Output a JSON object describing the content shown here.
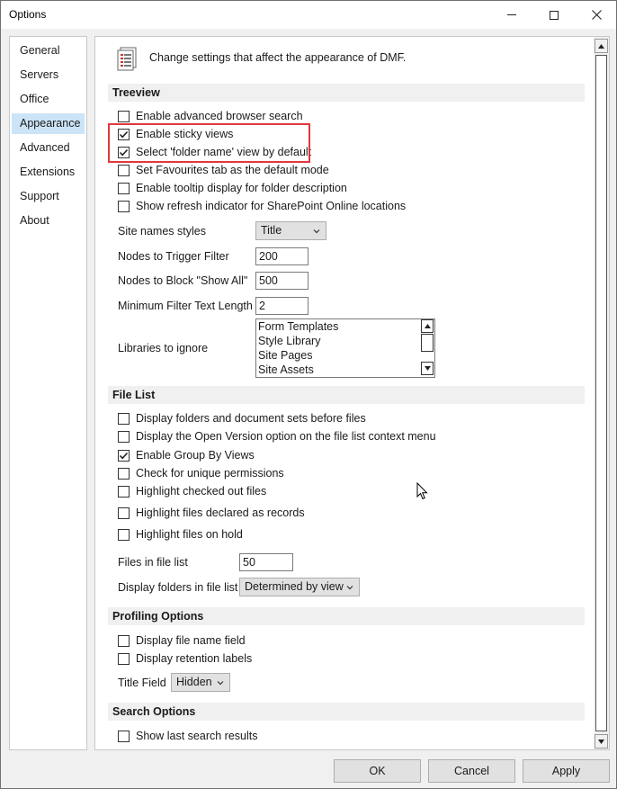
{
  "window": {
    "title": "Options"
  },
  "titlebar_buttons": {
    "minimize": "minimize-icon",
    "maximize": "maximize-icon",
    "close": "close-icon"
  },
  "nav": {
    "items": [
      {
        "label": "General"
      },
      {
        "label": "Servers"
      },
      {
        "label": "Office"
      },
      {
        "label": "Appearance",
        "selected": true
      },
      {
        "label": "Advanced"
      },
      {
        "label": "Extensions"
      },
      {
        "label": "Support"
      },
      {
        "label": "About"
      }
    ]
  },
  "header": {
    "text": "Change settings that affect the appearance of DMF.",
    "icon": "settings-document-icon"
  },
  "treeview": {
    "title": "Treeview",
    "checkboxes": [
      {
        "label": "Enable advanced browser search",
        "checked": false
      },
      {
        "label": "Enable sticky views",
        "checked": true
      },
      {
        "label": "Select 'folder name' view by default",
        "checked": true
      },
      {
        "label": "Set Favourites tab as the default mode",
        "checked": false
      },
      {
        "label": "Enable tooltip display for folder description",
        "checked": false
      },
      {
        "label": "Show refresh indicator for SharePoint Online locations",
        "checked": false
      }
    ],
    "site_names_styles": {
      "label": "Site names styles",
      "value": "Title"
    },
    "nodes_trigger": {
      "label": "Nodes to Trigger Filter",
      "value": "200"
    },
    "nodes_block": {
      "label": "Nodes to Block \"Show All\"",
      "value": "500"
    },
    "min_filter": {
      "label": "Minimum Filter Text Length",
      "value": "2"
    },
    "libraries": {
      "label": "Libraries to ignore",
      "items": [
        "Form Templates",
        "Style Library",
        "Site Pages",
        "Site Assets"
      ]
    }
  },
  "file_list": {
    "title": "File List",
    "checkboxes": [
      {
        "label": "Display folders and document sets before files",
        "checked": false
      },
      {
        "label": "Display the Open Version option on the file list context menu",
        "checked": false
      },
      {
        "label": "Enable Group By Views",
        "checked": true
      },
      {
        "label": "Check for unique permissions",
        "checked": false
      },
      {
        "label": "Highlight checked out files",
        "checked": false
      },
      {
        "label": "Highlight files declared as records",
        "checked": false
      },
      {
        "label": "Highlight files on hold",
        "checked": false
      }
    ],
    "files_in_list": {
      "label": "Files in file list",
      "value": "50"
    },
    "display_folders": {
      "label": "Display folders in file list",
      "value": "Determined by view"
    }
  },
  "profiling": {
    "title": "Profiling Options",
    "checkboxes": [
      {
        "label": "Display file name field",
        "checked": false
      },
      {
        "label": "Display retention labels",
        "checked": false
      }
    ],
    "title_field": {
      "label": "Title Field",
      "value": "Hidden"
    }
  },
  "search": {
    "title": "Search Options",
    "checkboxes": [
      {
        "label": "Show last search results",
        "checked": false
      }
    ]
  },
  "buttons": {
    "ok": "OK",
    "cancel": "Cancel",
    "apply": "Apply"
  },
  "colors": {
    "highlight": "#e0383e",
    "selected_nav": "#cce4f7"
  }
}
